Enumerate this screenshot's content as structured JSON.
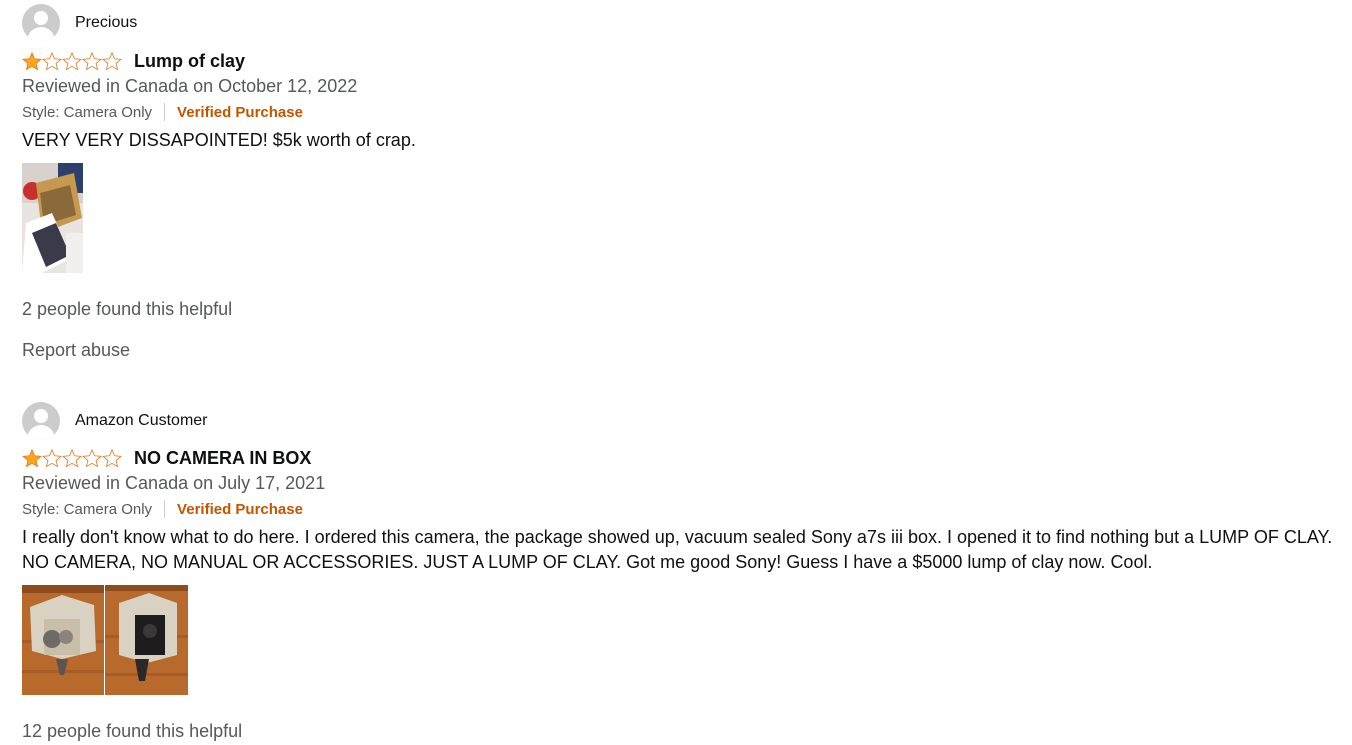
{
  "reviews": [
    {
      "reviewer": "Precious",
      "rating": 1,
      "max_rating": 5,
      "title": "Lump of clay",
      "date_line": "Reviewed in Canada on October 12, 2022",
      "style": "Style: Camera Only",
      "verified": "Verified Purchase",
      "body": "VERY VERY DISSAPOINTED! $5k worth of crap.",
      "helpful": "2 people found this helpful",
      "report": "Report abuse"
    },
    {
      "reviewer": "Amazon Customer",
      "rating": 1,
      "max_rating": 5,
      "title": "NO CAMERA IN BOX",
      "date_line": "Reviewed in Canada on July 17, 2021",
      "style": "Style: Camera Only",
      "verified": "Verified Purchase",
      "body": "I really don't know what to do here. I ordered this camera, the package showed up, vacuum sealed Sony a7s iii box. I opened it to find nothing but a LUMP OF CLAY. NO CAMERA, NO MANUAL OR ACCESSORIES. JUST A LUMP OF CLAY. Got me good Sony! Guess I have a $5000 lump of clay now. Cool.",
      "helpful": "12 people found this helpful"
    }
  ],
  "colors": {
    "star_fill": "#FFA41C",
    "star_outline": "#DE7921",
    "verified": "#C45500",
    "secondary_text": "#565959"
  }
}
